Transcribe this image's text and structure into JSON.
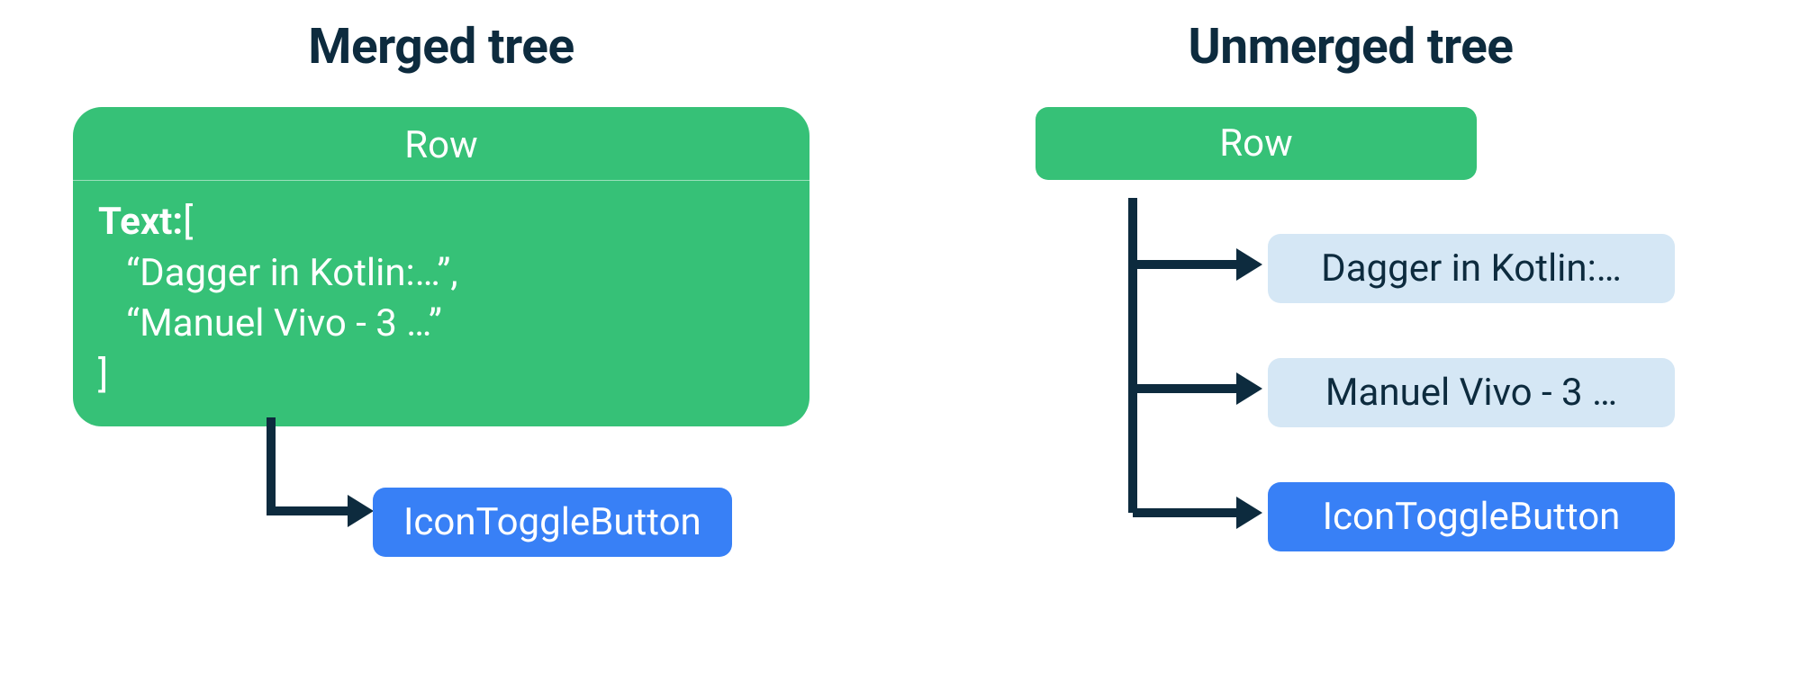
{
  "merged": {
    "heading": "Merged tree",
    "row_label": "Row",
    "text_label": "Text:",
    "open_bracket": "[",
    "item1": "“Dagger in Kotlin:…”,",
    "item2": "“Manuel Vivo - 3 …”",
    "close_bracket": "]",
    "child": "IconToggleButton"
  },
  "unmerged": {
    "heading": "Unmerged tree",
    "row_label": "Row",
    "child1": "Dagger in Kotlin:…",
    "child2": "Manuel Vivo - 3 …",
    "child3": "IconToggleButton"
  },
  "colors": {
    "dark": "#0d2b3e",
    "green": "#36c177",
    "blue": "#3880f6",
    "lightblue": "#d5e7f5"
  }
}
